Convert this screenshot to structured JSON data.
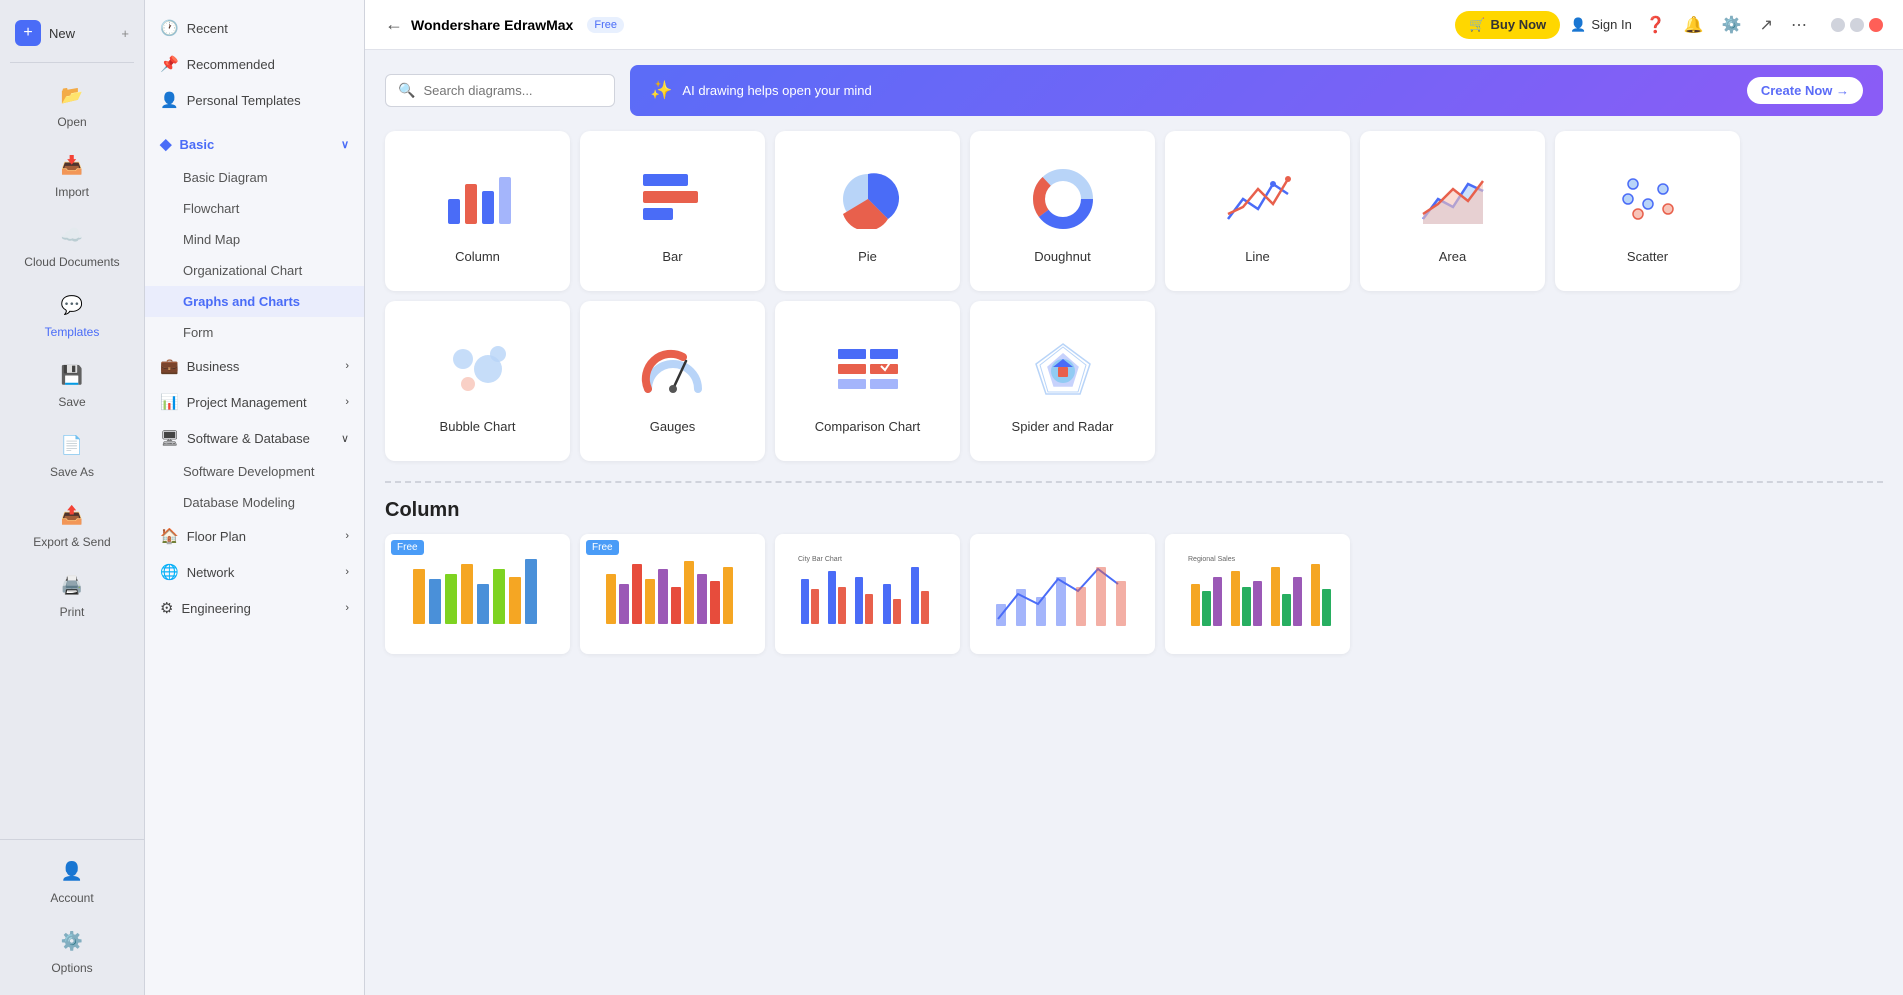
{
  "app": {
    "title": "Wondershare EdrawMax",
    "free_badge": "Free",
    "buy_now_label": "Buy Now",
    "sign_in_label": "Sign In"
  },
  "search": {
    "placeholder": "Search diagrams..."
  },
  "ai_banner": {
    "text": "AI drawing helps open your mind",
    "cta": "Create Now →"
  },
  "sidebar_left": {
    "items": [
      {
        "id": "new",
        "label": "New",
        "icon": "➕"
      },
      {
        "id": "open",
        "label": "Open",
        "icon": "📂"
      },
      {
        "id": "import",
        "label": "Import",
        "icon": "📥"
      },
      {
        "id": "cloud",
        "label": "Cloud Documents",
        "icon": "☁️"
      },
      {
        "id": "templates",
        "label": "Templates",
        "icon": "💬"
      },
      {
        "id": "save",
        "label": "Save",
        "icon": "💾"
      },
      {
        "id": "save-as",
        "label": "Save As",
        "icon": "📄"
      },
      {
        "id": "export",
        "label": "Export & Send",
        "icon": "📤"
      },
      {
        "id": "print",
        "label": "Print",
        "icon": "🖨️"
      }
    ],
    "bottom_items": [
      {
        "id": "account",
        "label": "Account",
        "icon": "👤"
      },
      {
        "id": "options",
        "label": "Options",
        "icon": "⚙️"
      }
    ]
  },
  "sidebar_nav": {
    "top_items": [
      {
        "id": "recent",
        "label": "Recent",
        "icon": "🕐"
      },
      {
        "id": "recommended",
        "label": "Recommended",
        "icon": "📌"
      },
      {
        "id": "personal",
        "label": "Personal Templates",
        "icon": "👤"
      }
    ],
    "categories": [
      {
        "id": "basic",
        "label": "Basic",
        "icon": "◆",
        "expanded": true,
        "active": true,
        "children": [
          {
            "id": "basic-diagram",
            "label": "Basic Diagram"
          },
          {
            "id": "flowchart",
            "label": "Flowchart"
          },
          {
            "id": "mind-map",
            "label": "Mind Map"
          },
          {
            "id": "org-chart",
            "label": "Organizational Chart"
          },
          {
            "id": "graphs-charts",
            "label": "Graphs and Charts",
            "active": true
          },
          {
            "id": "form",
            "label": "Form"
          }
        ]
      },
      {
        "id": "business",
        "label": "Business",
        "icon": "💼",
        "expanded": false
      },
      {
        "id": "project",
        "label": "Project Management",
        "icon": "📊",
        "expanded": false
      },
      {
        "id": "software-db",
        "label": "Software & Database",
        "icon": "🖥",
        "expanded": true,
        "children": [
          {
            "id": "software-dev",
            "label": "Software Development"
          },
          {
            "id": "db-modeling",
            "label": "Database Modeling"
          }
        ]
      },
      {
        "id": "floor-plan",
        "label": "Floor Plan",
        "icon": "🏠",
        "expanded": false
      },
      {
        "id": "network",
        "label": "Network",
        "icon": "🌐",
        "expanded": false
      },
      {
        "id": "engineering",
        "label": "Engineering",
        "icon": "⚙",
        "expanded": false
      }
    ]
  },
  "charts": [
    {
      "id": "column",
      "label": "Column",
      "type": "column"
    },
    {
      "id": "bar",
      "label": "Bar",
      "type": "bar"
    },
    {
      "id": "pie",
      "label": "Pie",
      "type": "pie"
    },
    {
      "id": "doughnut",
      "label": "Doughnut",
      "type": "doughnut"
    },
    {
      "id": "line",
      "label": "Line",
      "type": "line"
    },
    {
      "id": "area",
      "label": "Area",
      "type": "area"
    },
    {
      "id": "scatter",
      "label": "Scatter",
      "type": "scatter"
    },
    {
      "id": "bubble",
      "label": "Bubble Chart",
      "type": "bubble"
    },
    {
      "id": "gauges",
      "label": "Gauges",
      "type": "gauges"
    },
    {
      "id": "comparison",
      "label": "Comparison Chart",
      "type": "comparison"
    },
    {
      "id": "spider",
      "label": "Spider and Radar",
      "type": "spider"
    }
  ],
  "section": {
    "title": "Column"
  },
  "templates": [
    {
      "id": "t1",
      "free": true
    },
    {
      "id": "t2",
      "free": true
    },
    {
      "id": "t3",
      "free": false
    },
    {
      "id": "t4",
      "free": false
    },
    {
      "id": "t5",
      "free": false
    }
  ]
}
